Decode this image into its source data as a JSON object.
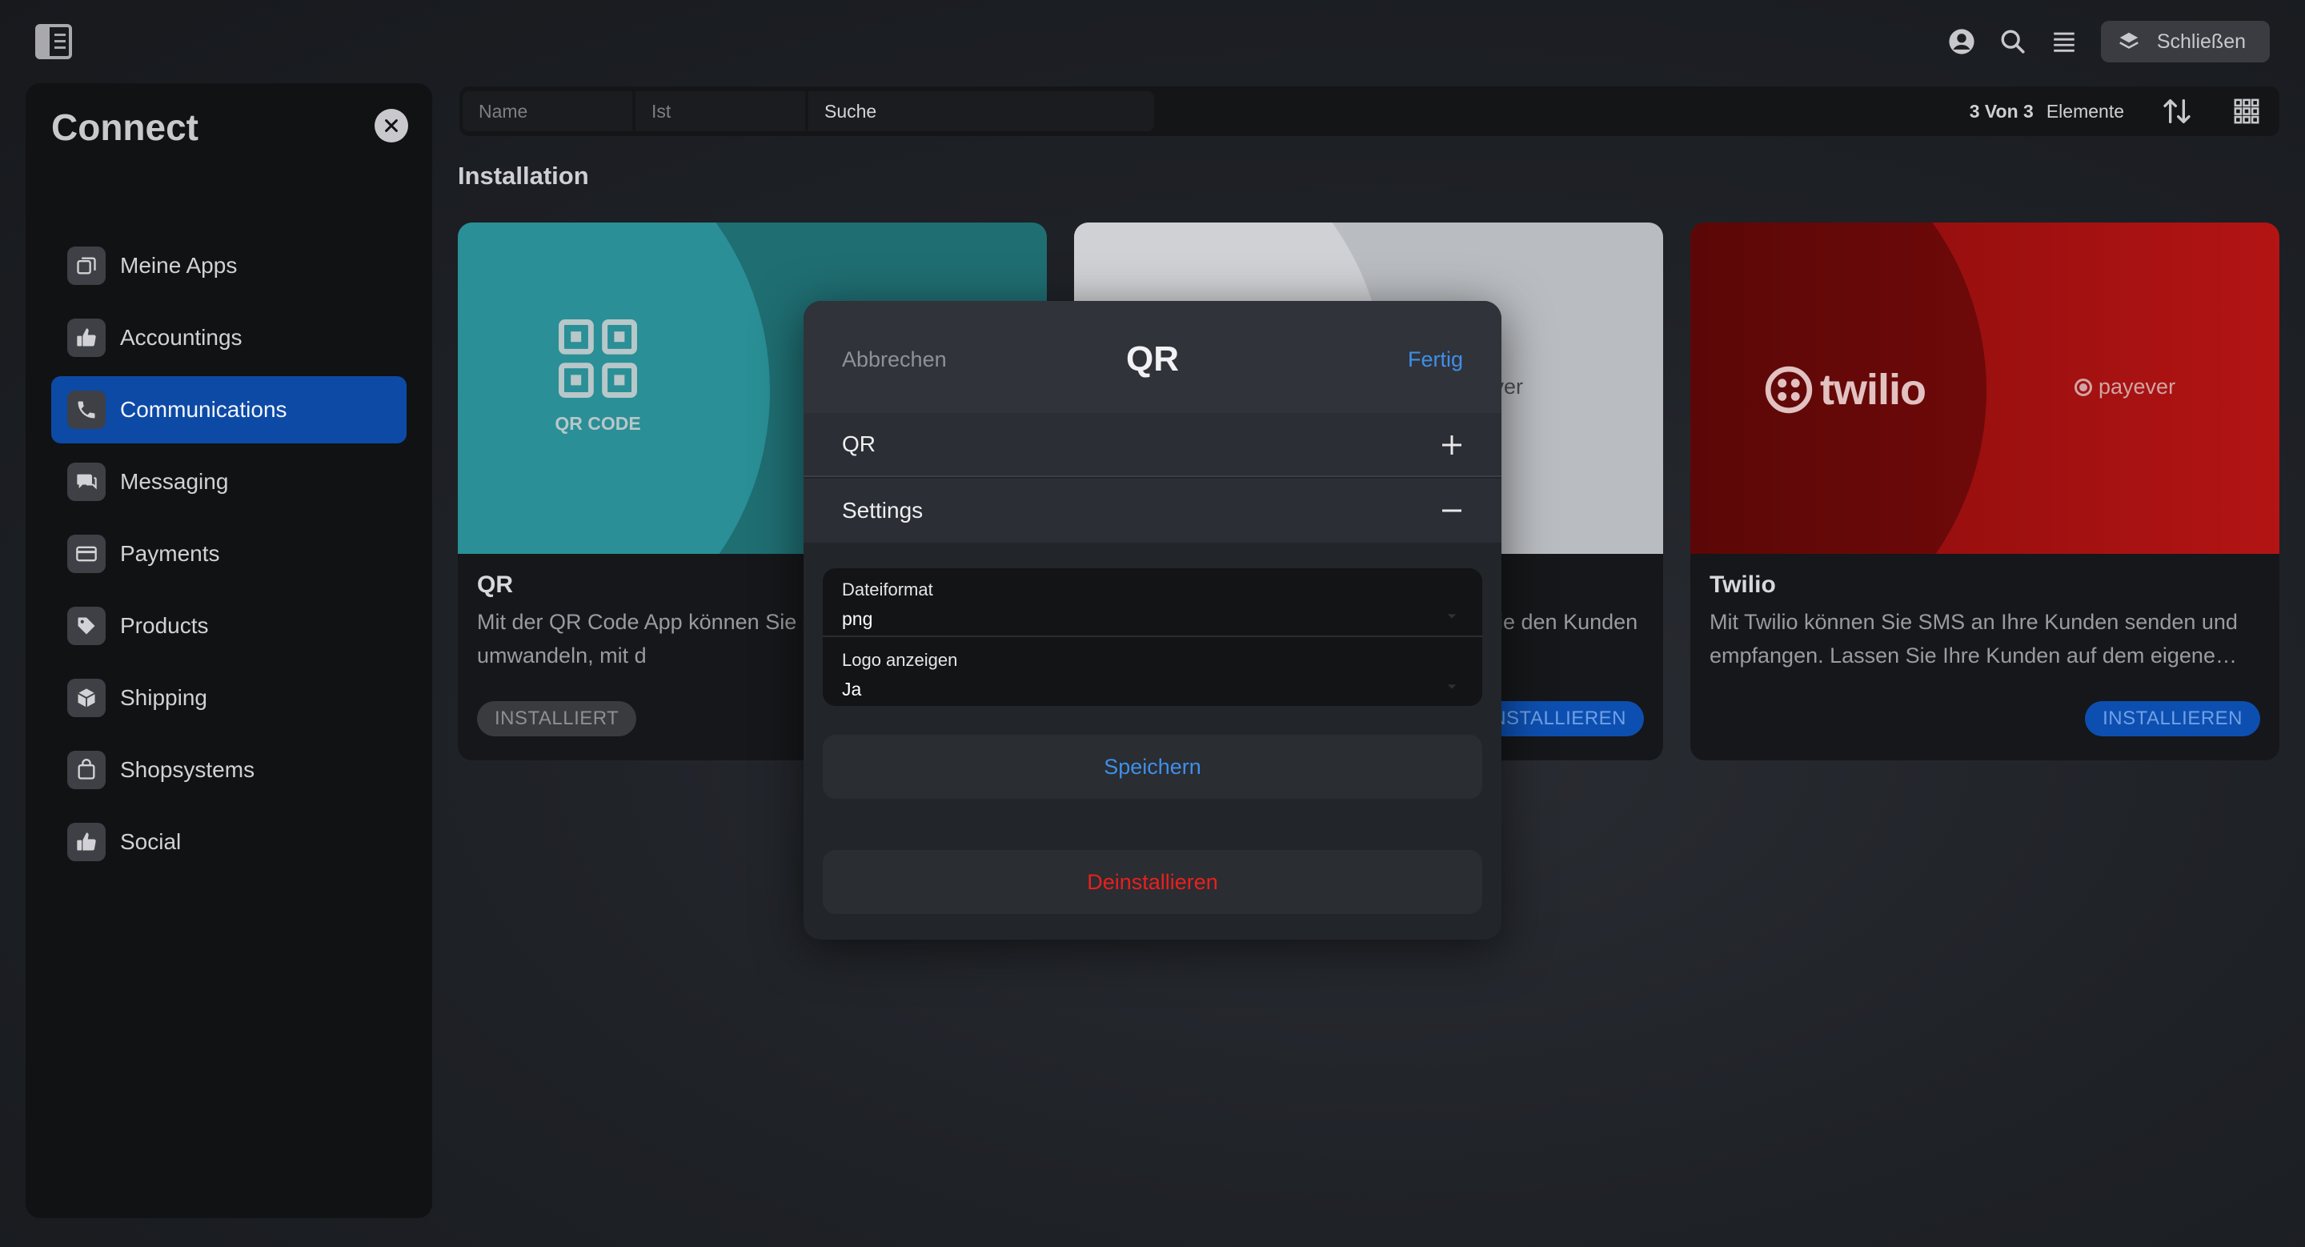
{
  "topbar": {
    "close_label": "Schließen"
  },
  "sidebar": {
    "title": "Connect",
    "items": [
      {
        "label": "Meine Apps"
      },
      {
        "label": "Accountings"
      },
      {
        "label": "Communications"
      },
      {
        "label": "Messaging"
      },
      {
        "label": "Payments"
      },
      {
        "label": "Products"
      },
      {
        "label": "Shipping"
      },
      {
        "label": "Shopsystems"
      },
      {
        "label": "Social"
      }
    ],
    "active_index": 2
  },
  "filter": {
    "field1": "Name",
    "field2": "Ist",
    "field3": "Suche",
    "count": "3 Von 3",
    "unit": "Elemente"
  },
  "section": {
    "title": "Installation"
  },
  "cards": [
    {
      "logo_text": "QR CODE",
      "title": "QR",
      "desc": "Mit der QR Code App können Sie einen QR Code umwandeln, mit d",
      "button": "INSTALLIERT"
    },
    {
      "partner": "ayever",
      "desc": "ie den Kunden",
      "button": "NSTALLIEREN"
    },
    {
      "logo_text": "twilio",
      "partner": "payever",
      "title": "Twilio",
      "desc": "Mit Twilio können Sie SMS an Ihre Kunden senden und empfangen. Lassen Sie Ihre Kunden auf dem eigene…",
      "button": "INSTALLIEREN"
    }
  ],
  "modal": {
    "cancel": "Abbrechen",
    "title": "QR",
    "done": "Fertig",
    "section_qr": "QR",
    "section_settings": "Settings",
    "fields": [
      {
        "label": "Dateiformat",
        "value": "png"
      },
      {
        "label": "Logo anzeigen",
        "value": "Ja"
      }
    ],
    "save": "Speichern",
    "uninstall": "Deinstallieren"
  },
  "colors": {
    "accent": "#0c4aa6",
    "link": "#3f8fe8",
    "danger": "#e8201e"
  }
}
